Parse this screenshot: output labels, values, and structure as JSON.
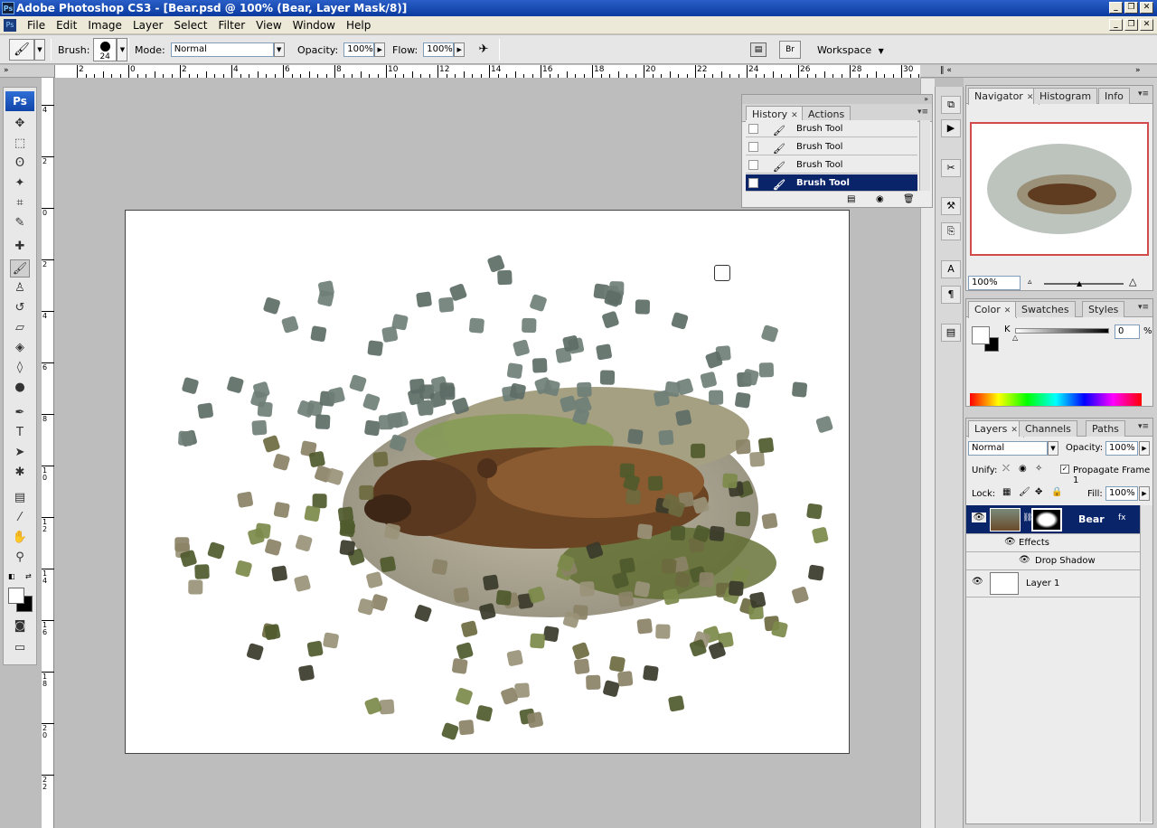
{
  "window": {
    "title": "Adobe Photoshop CS3 - [Bear.psd @ 100% (Bear, Layer Mask/8)]",
    "app_icon": "Ps"
  },
  "menu": [
    "File",
    "Edit",
    "Image",
    "Layer",
    "Select",
    "Filter",
    "View",
    "Window",
    "Help"
  ],
  "options": {
    "brush_label": "Brush:",
    "brush_size": "24",
    "mode_label": "Mode:",
    "mode_value": "Normal",
    "opacity_label": "Opacity:",
    "opacity_value": "100%",
    "flow_label": "Flow:",
    "flow_value": "100%",
    "workspace_label": "Workspace"
  },
  "ruler": {
    "h_labels": [
      "2",
      "0",
      "2",
      "4",
      "6",
      "8",
      "10",
      "12",
      "14",
      "16",
      "18",
      "20",
      "22",
      "24",
      "26",
      "28",
      "30"
    ],
    "v_labels": [
      "4",
      "2",
      "0",
      "2",
      "4",
      "6",
      "8",
      "1 0",
      "1 2",
      "1 4",
      "1 6",
      "1 8",
      "2 0",
      "2 2"
    ]
  },
  "toolbox": {
    "badge": "Ps"
  },
  "history": {
    "tabs": [
      "History",
      "Actions"
    ],
    "rows": [
      "Brush Tool",
      "Brush Tool",
      "Brush Tool",
      "Brush Tool"
    ],
    "selected_index": 3
  },
  "navigator": {
    "tabs": [
      "Navigator",
      "Histogram",
      "Info"
    ],
    "zoom": "100%"
  },
  "color": {
    "tabs": [
      "Color",
      "Swatches",
      "Styles"
    ],
    "channel": "K",
    "value": "0",
    "unit": "%"
  },
  "layers": {
    "tabs": [
      "Layers",
      "Channels",
      "Paths"
    ],
    "blend_mode": "Normal",
    "opacity_label": "Opacity:",
    "opacity_value": "100%",
    "unify_label": "Unify:",
    "propagate_label": "Propagate Frame 1",
    "lock_label": "Lock:",
    "fill_label": "Fill:",
    "fill_value": "100%",
    "items": [
      {
        "name": "Bear",
        "selected": true
      },
      {
        "name": "Effects"
      },
      {
        "name": "Drop Shadow"
      },
      {
        "name": "Layer 1"
      }
    ]
  },
  "colors": {
    "accent": "#0a246a",
    "titlebar": "#0a3a9e"
  }
}
